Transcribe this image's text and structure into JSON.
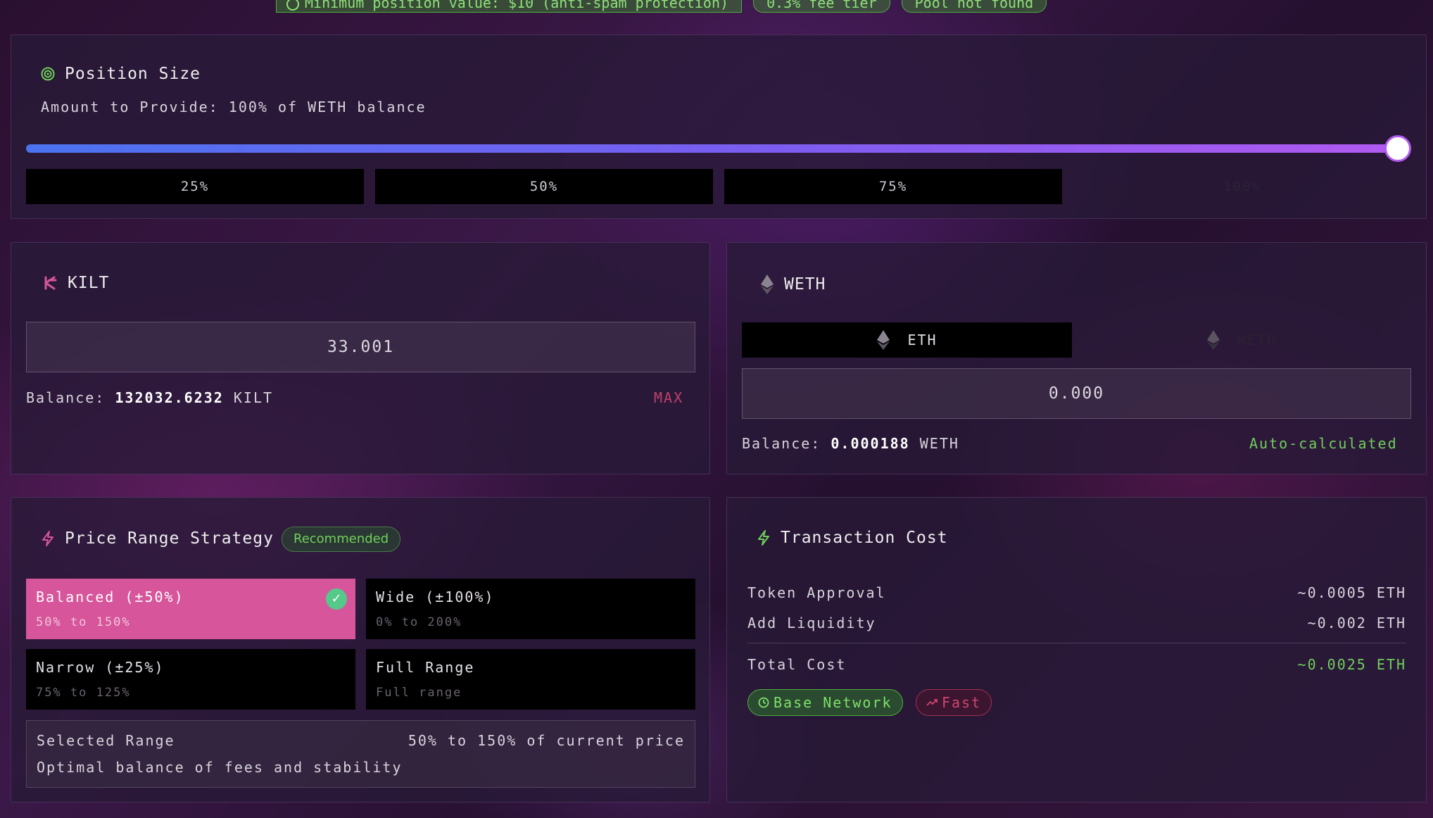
{
  "top_banner": {
    "min_value": "Minimum position value: $10 (anti-spam protection)",
    "fee_tier": "0.3% fee tier",
    "pool_status": "Pool not found"
  },
  "position_size": {
    "title": "Position Size",
    "amount_text": "Amount to Provide: 100% of WETH balance",
    "slider_percent": 100,
    "buttons": [
      "25%",
      "50%",
      "75%",
      "100%"
    ],
    "active_button": "100%"
  },
  "kilt_panel": {
    "title": "KILT",
    "amount": "33.001",
    "balance_label": "Balance:",
    "balance_value": "132032.6232",
    "balance_unit": "KILT",
    "max_label": "MAX"
  },
  "weth_panel": {
    "title": "WETH",
    "toggle": [
      "ETH",
      "WETH"
    ],
    "active_toggle": "ETH",
    "amount": "0.000",
    "balance_label": "Balance:",
    "balance_value": "0.000188",
    "balance_unit": "WETH",
    "auto_label": "Auto-calculated"
  },
  "strategy": {
    "title": "Price Range Strategy",
    "badge": "Recommended",
    "options": [
      {
        "name": "Balanced (±50%)",
        "sub": "50% to 150%"
      },
      {
        "name": "Wide (±100%)",
        "sub": "0% to 200%"
      },
      {
        "name": "Narrow (±25%)",
        "sub": "75% to 125%"
      },
      {
        "name": "Full Range",
        "sub": "Full range"
      }
    ],
    "selected": "Balanced (±50%)",
    "check": "✓",
    "selected_range_label": "Selected Range",
    "selected_range_value": "50% to 150% of current price",
    "selected_range_desc": "Optimal balance of fees and stability"
  },
  "transaction": {
    "title": "Transaction Cost",
    "rows": [
      {
        "label": "Token Approval",
        "value": "~0.0005 ETH"
      },
      {
        "label": "Add Liquidity",
        "value": "~0.002 ETH"
      }
    ],
    "total_label": "Total Cost",
    "total_value": "~0.0025 ETH",
    "network_pill": "Base Network",
    "speed_pill": "Fast"
  },
  "colors": {
    "accent_pink": "#d7559a",
    "accent_green": "#6fcf5a",
    "slider_start": "#4b73f0",
    "slider_end": "#b25af0"
  }
}
